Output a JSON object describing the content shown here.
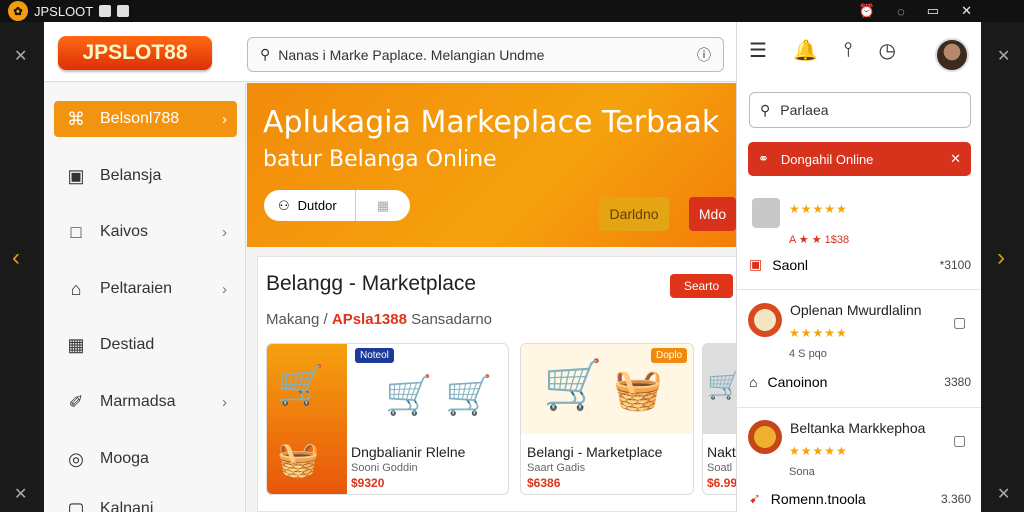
{
  "window": {
    "title": "JPSLOOT",
    "controls": [
      "⏰",
      "◌",
      "▭",
      "✕"
    ]
  },
  "app": {
    "brand": "JPSLOT88",
    "search_value": "Nanas i Marke Paplace.  Melangian Undme"
  },
  "sidebar": {
    "items": [
      {
        "label": "Belsonl788",
        "icon": "⌘",
        "chevron": true,
        "active": true
      },
      {
        "label": "Belansja",
        "icon": "▣",
        "chevron": false,
        "active": false
      },
      {
        "label": "Kaivos",
        "icon": "□",
        "chevron": true,
        "active": false
      },
      {
        "label": "Peltaraien",
        "icon": "⌂",
        "chevron": true,
        "active": false
      },
      {
        "label": "Destiad",
        "icon": "▦",
        "chevron": false,
        "active": false
      },
      {
        "label": "Marmadsa",
        "icon": "✐",
        "chevron": true,
        "active": false
      },
      {
        "label": "Mooga",
        "icon": "◎",
        "chevron": false,
        "active": false
      },
      {
        "label": "Kalnani",
        "icon": "▢",
        "chevron": false,
        "active": false
      }
    ]
  },
  "hero": {
    "title": "Aplukagia Markeplace Terbaak",
    "subtitle": "batur Belanga Online",
    "pill_label": "Dutdor",
    "btn1": "Darldno",
    "btn2": "Mdo"
  },
  "market": {
    "title": "Belangg - Marketplace",
    "button": "Searto",
    "sub_prefix": "Makang /",
    "sub_highlight": "APsla1388",
    "sub_suffix": "Sansadarno",
    "cards": [
      {
        "name": "Dngbalianir Rlelne",
        "meta": "Sooni Goddin",
        "price": "$9320",
        "badge": "Noteol"
      },
      {
        "name": "Belangi - Marketplace",
        "meta": "Saart Gadis",
        "price": "$6386",
        "badge": "Doplo"
      },
      {
        "name": "Nakt",
        "meta": "Soatl",
        "price": "$6.99",
        "badge": ""
      }
    ]
  },
  "right_panel": {
    "search_value": "Parlaea",
    "banner": "Dongahil Online",
    "items": [
      {
        "title": "",
        "stars": "★★★★★",
        "sub": "A ★ ★ 1$38",
        "foot_label": "Saonl",
        "foot_value": "*3100"
      },
      {
        "title": "Oplenan Mwurdlalinn",
        "stars": "★★★★★",
        "sub": "4 S pqo",
        "foot_label": "Canoinon",
        "foot_value": "3380"
      },
      {
        "title": "Beltanka Markkephoa",
        "stars": "★★★★★",
        "sub": "Sona",
        "foot_label": "Romenn.tnoola",
        "foot_value": "3.360"
      }
    ]
  }
}
